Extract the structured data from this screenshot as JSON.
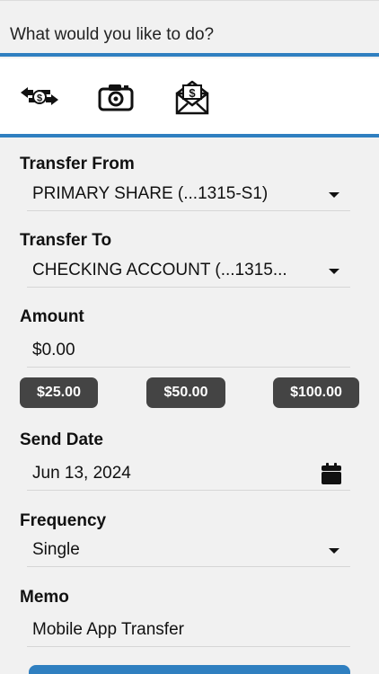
{
  "header": {
    "prompt": "What would you like to do?"
  },
  "actions": {
    "icons": [
      "transfer-money-icon",
      "camera-deposit-icon",
      "bill-pay-envelope-icon"
    ]
  },
  "form": {
    "transfer_from": {
      "label": "Transfer From",
      "value": "PRIMARY SHARE (...1315-S1)"
    },
    "transfer_to": {
      "label": "Transfer To",
      "value": "CHECKING ACCOUNT (...1315..."
    },
    "amount": {
      "label": "Amount",
      "value": "$0.00"
    },
    "quick_amounts": [
      "$25.00",
      "$50.00",
      "$100.00"
    ],
    "send_date": {
      "label": "Send Date",
      "value": "Jun 13, 2024"
    },
    "frequency": {
      "label": "Frequency",
      "value": "Single"
    },
    "memo": {
      "label": "Memo",
      "value": "Mobile App Transfer"
    }
  },
  "colors": {
    "accent": "#2f7fc0",
    "quick_button": "#444444",
    "background": "#f1f1f1"
  }
}
